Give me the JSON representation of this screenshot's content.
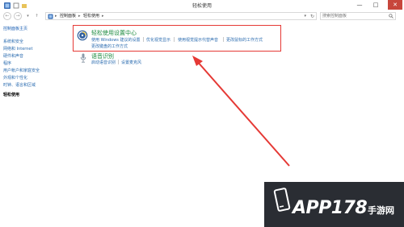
{
  "window": {
    "title": "轻松使用",
    "min_glyph": "—",
    "max_glyph": "□",
    "close_glyph": "✕"
  },
  "address": {
    "back_glyph": "←",
    "forward_glyph": "→",
    "up_glyph": "↑",
    "breadcrumbs": [
      "控制面板",
      "轻松使用"
    ],
    "separator": "▸",
    "dropdown_glyph": "▾",
    "refresh_glyph": "↻"
  },
  "search": {
    "placeholder": "搜索控制面板"
  },
  "sidebar": {
    "home": "控制面板主页",
    "items": [
      "系统和安全",
      "网络和 Internet",
      "硬件和声音",
      "程序",
      "用户帐户和家庭安全",
      "外观和个性化",
      "时钟、语言和区域",
      "轻松使用"
    ],
    "current": "轻松使用"
  },
  "sections": [
    {
      "title": "轻松使用设置中心",
      "icon": "ease-of-access-icon",
      "links": [
        "使用 Windows 建议的设置",
        "优化视觉显示",
        "使用视觉提示代替声音",
        "更改鼠标的工作方式",
        "更改键盘的工作方式"
      ]
    },
    {
      "title": "语音识别",
      "icon": "microphone-icon",
      "links": [
        "启动语音识别",
        "设置麦克风"
      ]
    }
  ],
  "annotation": {
    "box_color": "#e53935",
    "arrow_color": "#e53935"
  },
  "watermark": {
    "brand": "APP178",
    "suffix": "手游网"
  },
  "colors": {
    "link": "#2b6cb0",
    "section_title": "#1b8a3e",
    "close": "#c7463c"
  }
}
